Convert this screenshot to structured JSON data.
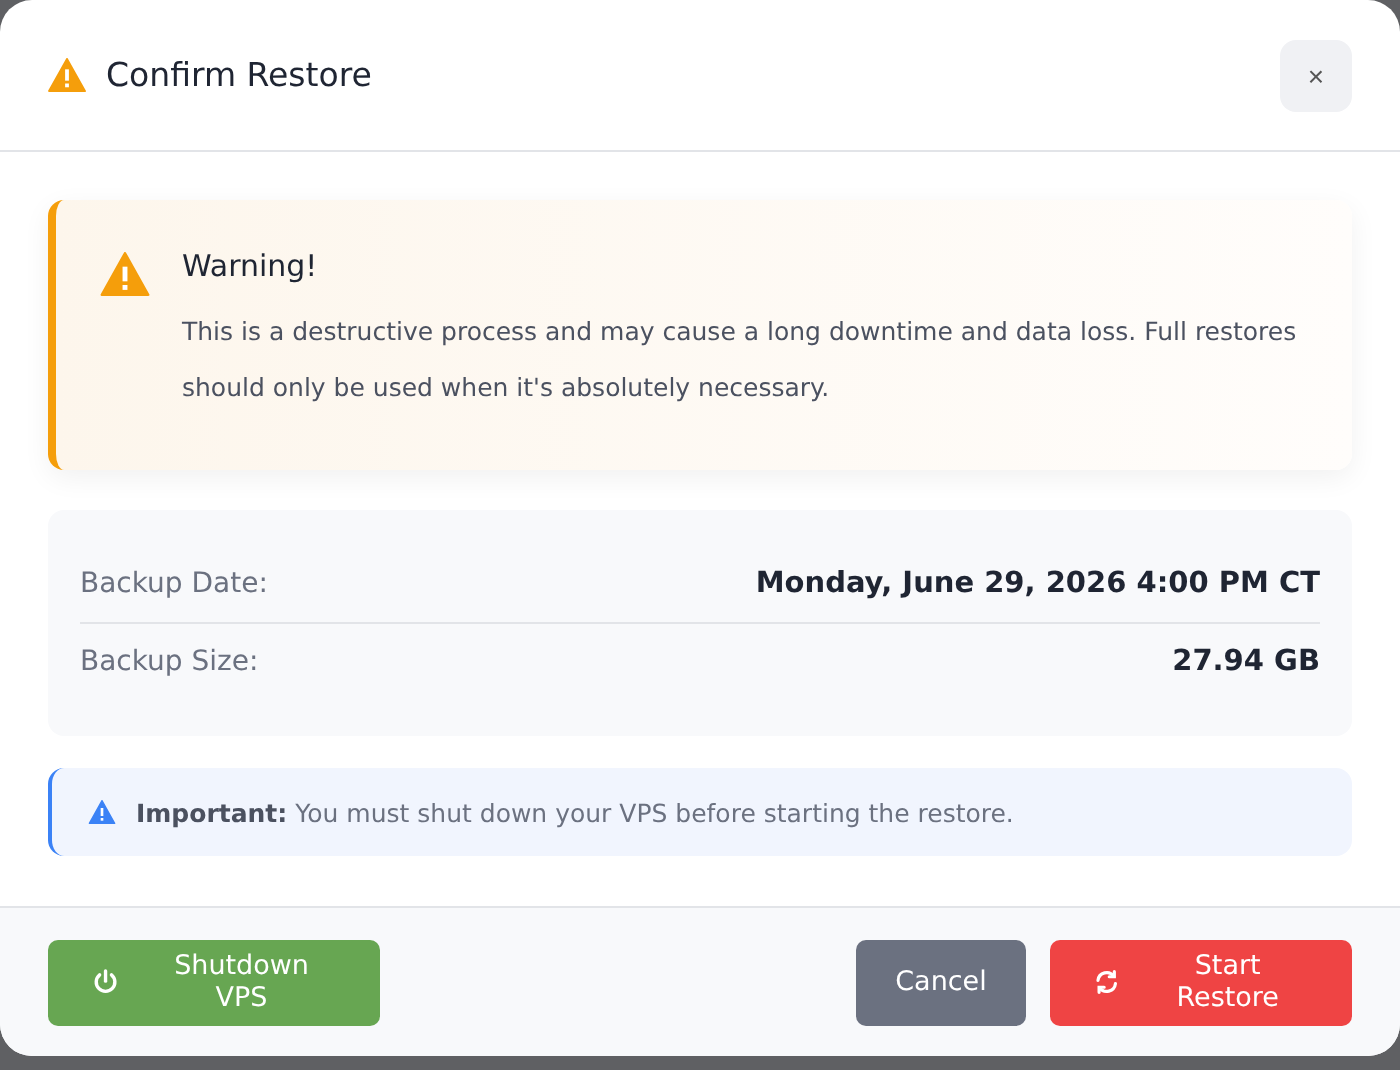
{
  "dialog": {
    "title": "Confirm Restore",
    "close": "×"
  },
  "warning": {
    "title": "Warning!",
    "text": "This is a destructive process and may cause a long downtime and data loss. Full restores should only be used when it's absolutely necessary."
  },
  "details": [
    {
      "label": "Backup Date:",
      "value": "Monday, June 29, 2026 4:00 PM CT"
    },
    {
      "label": "Backup Size:",
      "value": "27.94 GB"
    }
  ],
  "notice": {
    "text": "**Important:** You must shut down your VPS before starting the restore."
  },
  "footer": {
    "left_buttons": [
      {
        "label": "Shutdown VPS",
        "kind": "success"
      }
    ],
    "right_buttons": [
      {
        "label": "Cancel",
        "kind": "secondary"
      },
      {
        "label": "Start Restore",
        "kind": "danger"
      }
    ]
  }
}
